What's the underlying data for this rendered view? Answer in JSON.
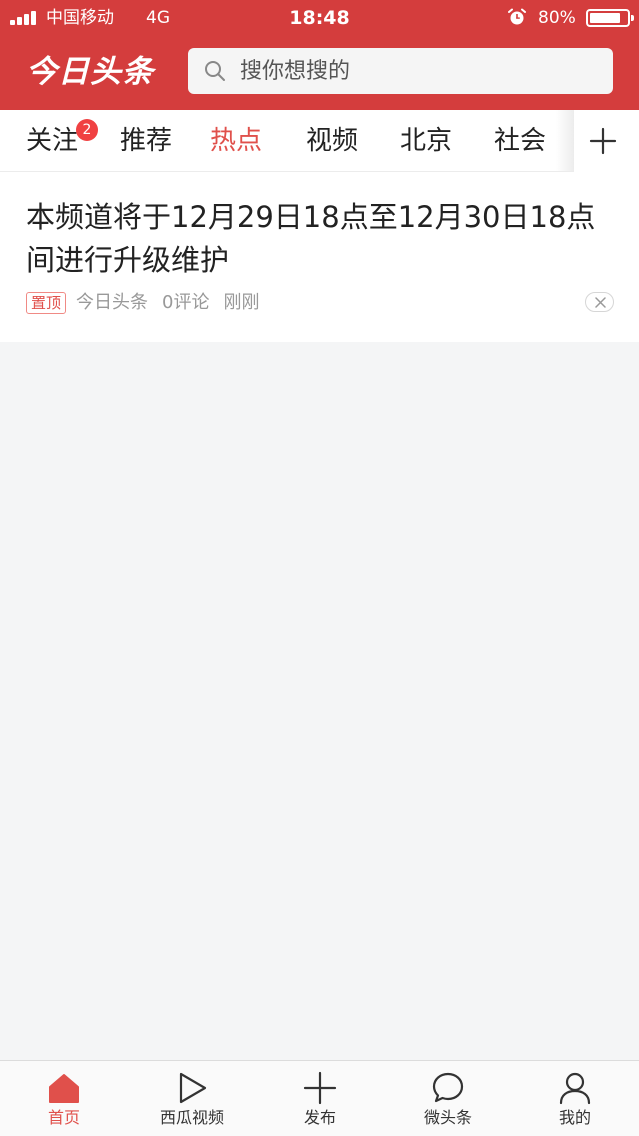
{
  "status_bar": {
    "carrier": "中国移动",
    "network": "4G",
    "time": "18:48",
    "battery_percent": "80%",
    "icons": [
      "signal-icon",
      "alarm-icon",
      "battery-icon"
    ]
  },
  "app_bar": {
    "logo": "今日头条",
    "search_placeholder": "搜你想搜的",
    "search_icon": "search-icon"
  },
  "tabs": [
    {
      "label": "关注",
      "badge": "2"
    },
    {
      "label": "推荐"
    },
    {
      "label": "热点",
      "active": true
    },
    {
      "label": "视频"
    },
    {
      "label": "北京"
    },
    {
      "label": "社会"
    }
  ],
  "add_tab_icon": "plus-icon",
  "feed": [
    {
      "title": "本频道将于12月29日18点至12月30日18点间进行升级维护",
      "tag": "置顶",
      "source": "今日头条",
      "comments": "0评论",
      "time": "刚刚",
      "dismiss_icon": "close-icon"
    }
  ],
  "bottom_nav": [
    {
      "label": "首页",
      "icon": "home-icon",
      "active": true
    },
    {
      "label": "西瓜视频",
      "icon": "play-icon"
    },
    {
      "label": "发布",
      "icon": "plus-icon"
    },
    {
      "label": "微头条",
      "icon": "chat-bubble-icon"
    },
    {
      "label": "我的",
      "icon": "user-icon"
    }
  ],
  "colors": {
    "brand_red": "#d43d3d",
    "active_tab": "#e0504b",
    "badge": "#f04142",
    "background": "#f4f5f6"
  }
}
